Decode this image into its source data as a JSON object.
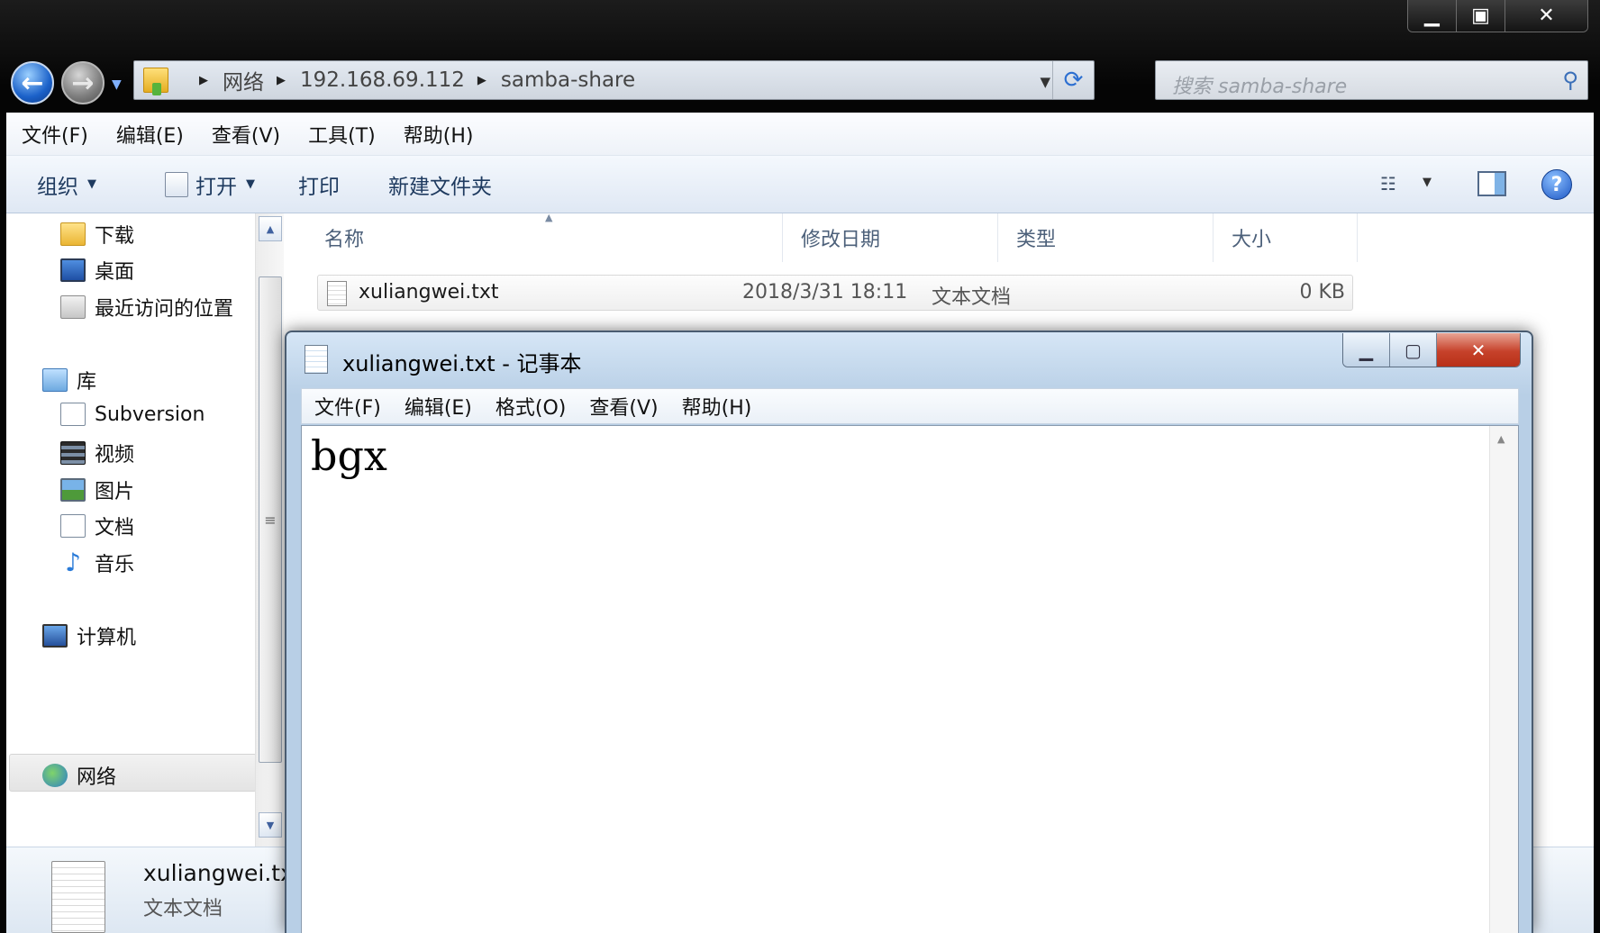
{
  "explorer": {
    "breadcrumb": [
      "网络",
      "192.168.69.112",
      "samba-share"
    ],
    "search_placeholder": "搜索 samba-share",
    "menu": [
      "文件(F)",
      "编辑(E)",
      "查看(V)",
      "工具(T)",
      "帮助(H)"
    ],
    "toolbar": {
      "organize": "组织",
      "open": "打开",
      "print": "打印",
      "new_folder": "新建文件夹"
    },
    "nav": {
      "downloads": "下载",
      "desktop": "桌面",
      "recent": "最近访问的位置",
      "libraries": "库",
      "subversion": "Subversion",
      "videos": "视频",
      "pictures": "图片",
      "documents": "文档",
      "music": "音乐",
      "computer": "计算机",
      "network": "网络"
    },
    "columns": {
      "name": "名称",
      "modified": "修改日期",
      "type": "类型",
      "size": "大小"
    },
    "files": [
      {
        "name": "xuliangwei.txt",
        "modified": "2018/3/31 18:11",
        "type": "文本文档",
        "size": "0 KB"
      }
    ],
    "details": {
      "name": "xuliangwei.txt",
      "type": "文本文档"
    }
  },
  "notepad": {
    "title": "xuliangwei.txt - 记事本",
    "menu": [
      "文件(F)",
      "编辑(E)",
      "格式(O)",
      "查看(V)",
      "帮助(H)"
    ],
    "content": "bgx"
  },
  "icons": [
    "back-icon",
    "forward-icon",
    "refresh-icon",
    "search-icon",
    "help-icon",
    "text-file-icon"
  ]
}
